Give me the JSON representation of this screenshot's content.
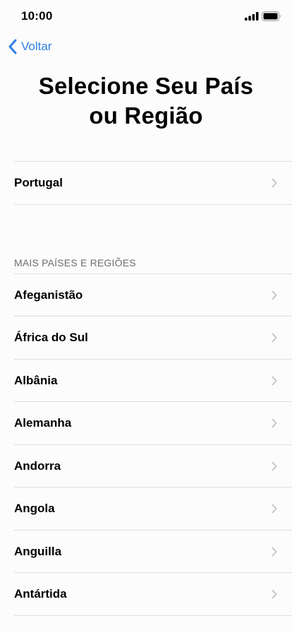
{
  "status_bar": {
    "time": "10:00",
    "signal_icon": "cellular-signal-icon",
    "battery_icon": "battery-icon"
  },
  "nav": {
    "back_label": "Voltar",
    "back_icon": "chevron-left-icon",
    "accent_color": "#2f7fe6"
  },
  "title_line1": "Selecione Seu País",
  "title_line2": "ou Região",
  "current_region": {
    "label": "Portugal"
  },
  "section_header": "MAIS PAÍSES E REGIÕES",
  "countries": [
    {
      "label": "Afeganistão"
    },
    {
      "label": "África do Sul"
    },
    {
      "label": "Albânia"
    },
    {
      "label": "Alemanha"
    },
    {
      "label": "Andorra"
    },
    {
      "label": "Angola"
    },
    {
      "label": "Anguilla"
    },
    {
      "label": "Antártida"
    }
  ]
}
